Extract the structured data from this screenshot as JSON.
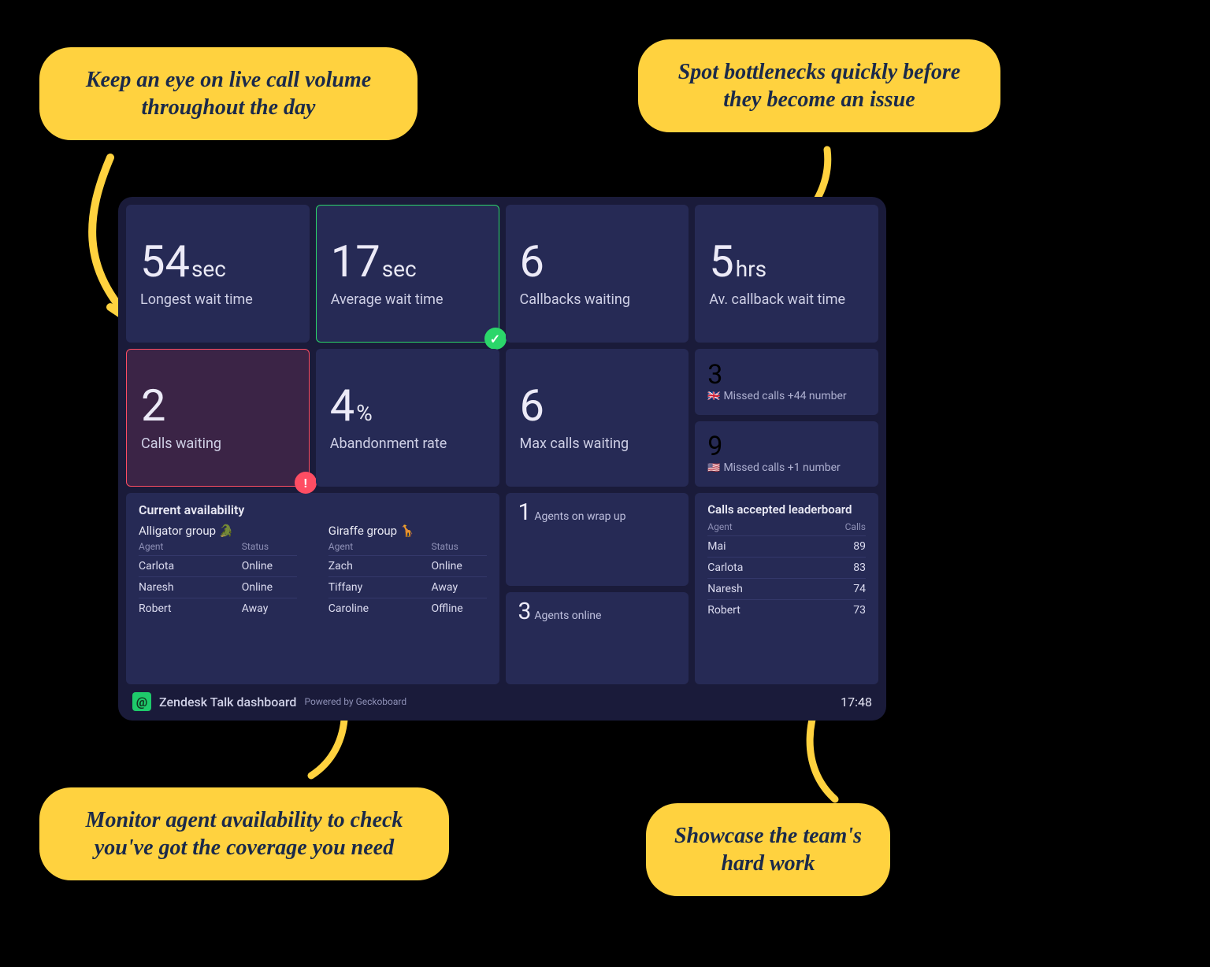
{
  "callouts": {
    "top_left": "Keep an eye on live call volume throughout the day",
    "top_right": "Spot bottlenecks quickly before they become an issue",
    "bottom_left": "Monitor agent availability to check you've got the coverage you need",
    "bottom_right": "Showcase the team's hard work"
  },
  "stats": {
    "longest_wait": {
      "value": "54",
      "unit": "sec",
      "label": "Longest wait time"
    },
    "avg_wait": {
      "value": "17",
      "unit": "sec",
      "label": "Average wait time"
    },
    "callbacks": {
      "value": "6",
      "unit": "",
      "label": "Callbacks waiting"
    },
    "avg_callback": {
      "value": "5",
      "unit": "hrs",
      "label": "Av. callback wait time"
    },
    "calls_waiting": {
      "value": "2",
      "unit": "",
      "label": "Calls waiting"
    },
    "abandon": {
      "value": "4",
      "unit": "%",
      "label": "Abandonment rate"
    },
    "max_calls": {
      "value": "6",
      "unit": "",
      "label": "Max calls waiting"
    },
    "missed_uk": {
      "value": "3",
      "flag": "🇬🇧",
      "label": "Missed calls +44 number"
    },
    "missed_us": {
      "value": "9",
      "flag": "🇺🇸",
      "label": "Missed calls +1 number"
    },
    "wrap_up": {
      "value": "1",
      "label": "Agents on wrap up"
    },
    "agents_online": {
      "value": "3",
      "label": "Agents online"
    }
  },
  "availability": {
    "title": "Current availability",
    "headers": {
      "agent": "Agent",
      "status": "Status"
    },
    "groups": [
      {
        "name": "Alligator group",
        "emoji": "🐊",
        "agents": [
          {
            "name": "Carlota",
            "status": "Online"
          },
          {
            "name": "Naresh",
            "status": "Online"
          },
          {
            "name": "Robert",
            "status": "Away"
          }
        ]
      },
      {
        "name": "Giraffe group",
        "emoji": "🦒",
        "agents": [
          {
            "name": "Zach",
            "status": "Online"
          },
          {
            "name": "Tiffany",
            "status": "Away"
          },
          {
            "name": "Caroline",
            "status": "Offline"
          }
        ]
      }
    ]
  },
  "leaderboard": {
    "title": "Calls accepted leaderboard",
    "headers": {
      "agent": "Agent",
      "calls": "Calls"
    },
    "rows": [
      {
        "agent": "Mai",
        "calls": "89"
      },
      {
        "agent": "Carlota",
        "calls": "83"
      },
      {
        "agent": "Naresh",
        "calls": "74"
      },
      {
        "agent": "Robert",
        "calls": "73"
      }
    ]
  },
  "footer": {
    "title": "Zendesk Talk dashboard",
    "powered": "Powered by Geckoboard",
    "time": "17:48"
  },
  "icons": {
    "check": "✓",
    "alert": "!"
  }
}
